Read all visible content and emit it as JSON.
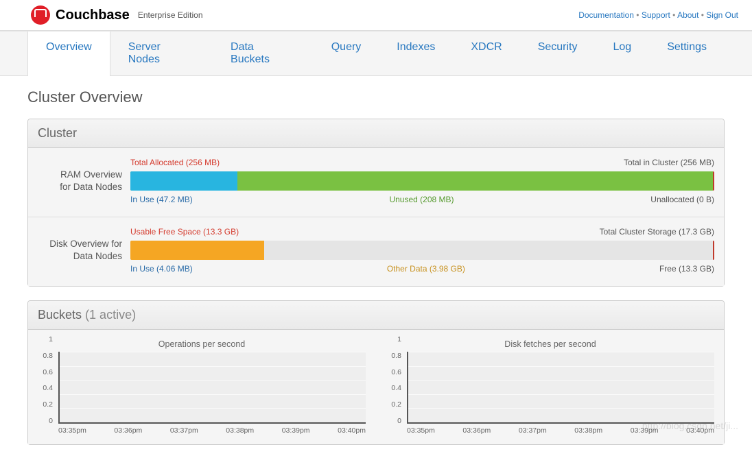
{
  "brand": {
    "name": "Couchbase",
    "edition": "Enterprise Edition"
  },
  "header_links": [
    {
      "label": "Documentation"
    },
    {
      "label": "Support"
    },
    {
      "label": "About"
    },
    {
      "label": "Sign Out"
    }
  ],
  "nav": [
    {
      "label": "Overview",
      "active": true
    },
    {
      "label": "Server Nodes"
    },
    {
      "label": "Data Buckets"
    },
    {
      "label": "Query"
    },
    {
      "label": "Indexes"
    },
    {
      "label": "XDCR"
    },
    {
      "label": "Security"
    },
    {
      "label": "Log"
    },
    {
      "label": "Settings"
    }
  ],
  "page_title": "Cluster Overview",
  "cluster_panel": {
    "title": "Cluster",
    "ram": {
      "label1": "RAM Overview",
      "label2": "for Data Nodes",
      "top_left": "Total Allocated (256 MB)",
      "top_right": "Total in Cluster (256 MB)",
      "bottom_left": "In Use (47.2 MB)",
      "bottom_mid": "Unused (208 MB)",
      "bottom_right": "Unallocated (0 B)",
      "inuse_pct": 18.4,
      "unused_pct": 81.6
    },
    "disk": {
      "label1": "Disk Overview for",
      "label2": "Data Nodes",
      "top_left": "Usable Free Space (13.3 GB)",
      "top_right": "Total Cluster Storage (17.3 GB)",
      "bottom_left": "In Use (4.06 MB)",
      "bottom_mid": "Other Data (3.98 GB)",
      "bottom_right": "Free (13.3 GB)",
      "inuse_pct": 0.02,
      "other_pct": 23.0
    }
  },
  "buckets_panel": {
    "title": "Buckets",
    "subtitle": "(1 active)"
  },
  "chart_data": [
    {
      "type": "line",
      "title": "Operations per second",
      "x": [
        "03:35pm",
        "03:36pm",
        "03:37pm",
        "03:38pm",
        "03:39pm",
        "03:40pm"
      ],
      "values": [
        0,
        0,
        0,
        0,
        0,
        0
      ],
      "ylim": [
        0,
        1
      ],
      "yticks": [
        0,
        0.2,
        0.4,
        0.6,
        0.8,
        1
      ]
    },
    {
      "type": "line",
      "title": "Disk fetches per second",
      "x": [
        "03:35pm",
        "03:36pm",
        "03:37pm",
        "03:38pm",
        "03:39pm",
        "03:40pm"
      ],
      "values": [
        0,
        0,
        0,
        0,
        0,
        0
      ],
      "ylim": [
        0,
        1
      ],
      "yticks": [
        0,
        0.2,
        0.4,
        0.6,
        0.8,
        1
      ]
    }
  ],
  "watermark": "http://blog.csdn.net/ji..."
}
